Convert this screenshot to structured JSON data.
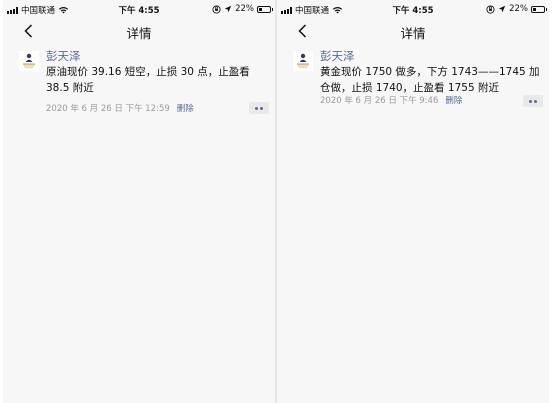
{
  "status_bar": {
    "carrier": "中国联通",
    "time": "下午 4:55",
    "battery": "22%"
  },
  "nav": {
    "title": "详情"
  },
  "colors": {
    "link": "#576b95",
    "background": "#f7f7f7",
    "meta": "#9b9b9b"
  },
  "posts": [
    {
      "author": "彭天泽",
      "content": "原油现价 39.16 短空，止损 30 点，止盈看 38.5 附近",
      "date": "2020 年 6 月 26 日 下午 12:59",
      "delete": "删除"
    },
    {
      "author": "彭天泽",
      "content": "黄金现价 1750 做多，下方 1743——1745 加仓做，止损 1740，止盈看 1755 附近",
      "date": "2020 年 6 月 26 日 下午 9:46",
      "delete": "删除"
    }
  ]
}
